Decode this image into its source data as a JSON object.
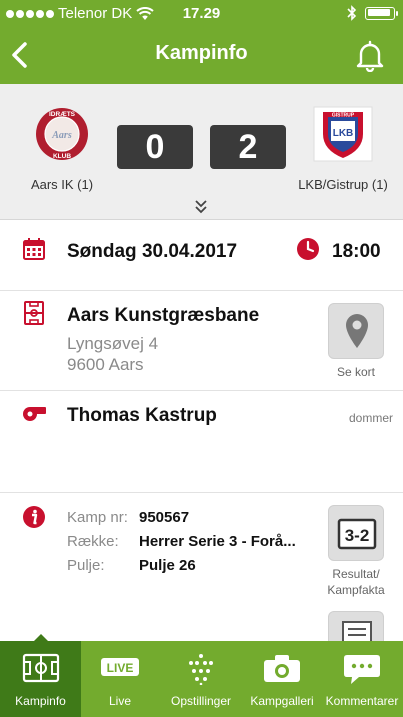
{
  "status_bar": {
    "carrier": "Telenor DK",
    "time": "17.29",
    "battery_level": 0.9
  },
  "nav": {
    "title": "Kampinfo"
  },
  "match": {
    "home_team": "Aars IK (1)",
    "away_team": "LKB/Gistrup (1)",
    "home_score": "0",
    "away_score": "2"
  },
  "logos": {
    "home_top": "IDRÆTS",
    "home_mid": "Aars",
    "home_bottom": "KLUB",
    "away_top": "GISTRUP",
    "away_letters": "LKB"
  },
  "date_row": {
    "date": "Søndag 30.04.2017",
    "time": "18:00"
  },
  "venue": {
    "name": "Aars Kunstgræsbane",
    "address_line1": "Lyngsøvej 4",
    "address_line2": "9600 Aars",
    "map_label": "Se kort"
  },
  "referee": {
    "name": "Thomas Kastrup",
    "role": "dommer"
  },
  "info": {
    "rows": [
      {
        "key": "Kamp nr:",
        "value": "950567"
      },
      {
        "key": "Række:",
        "value": "Herrer Serie 3 - Forå..."
      },
      {
        "key": "Pulje:",
        "value": "Pulje 26"
      }
    ],
    "result_display": "3-2",
    "result_label_line1": "Resultat/",
    "result_label_line2": "Kampfakta"
  },
  "tabs": [
    {
      "label": "Kampinfo",
      "icon": "pitch-icon",
      "active": true
    },
    {
      "label": "Live",
      "icon": "live-icon",
      "badge_text": "LIVE",
      "active": false
    },
    {
      "label": "Opstillinger",
      "icon": "lineup-dots-icon",
      "active": false
    },
    {
      "label": "Kampgalleri",
      "icon": "camera-icon",
      "active": false
    },
    {
      "label": "Kommentarer",
      "icon": "speech-bubble-icon",
      "active": false
    }
  ],
  "colors": {
    "brand_green": "#73ab2e",
    "active_tab": "#3f7a18",
    "accent_red": "#c8102e",
    "score_bg": "#3a3a3a"
  }
}
